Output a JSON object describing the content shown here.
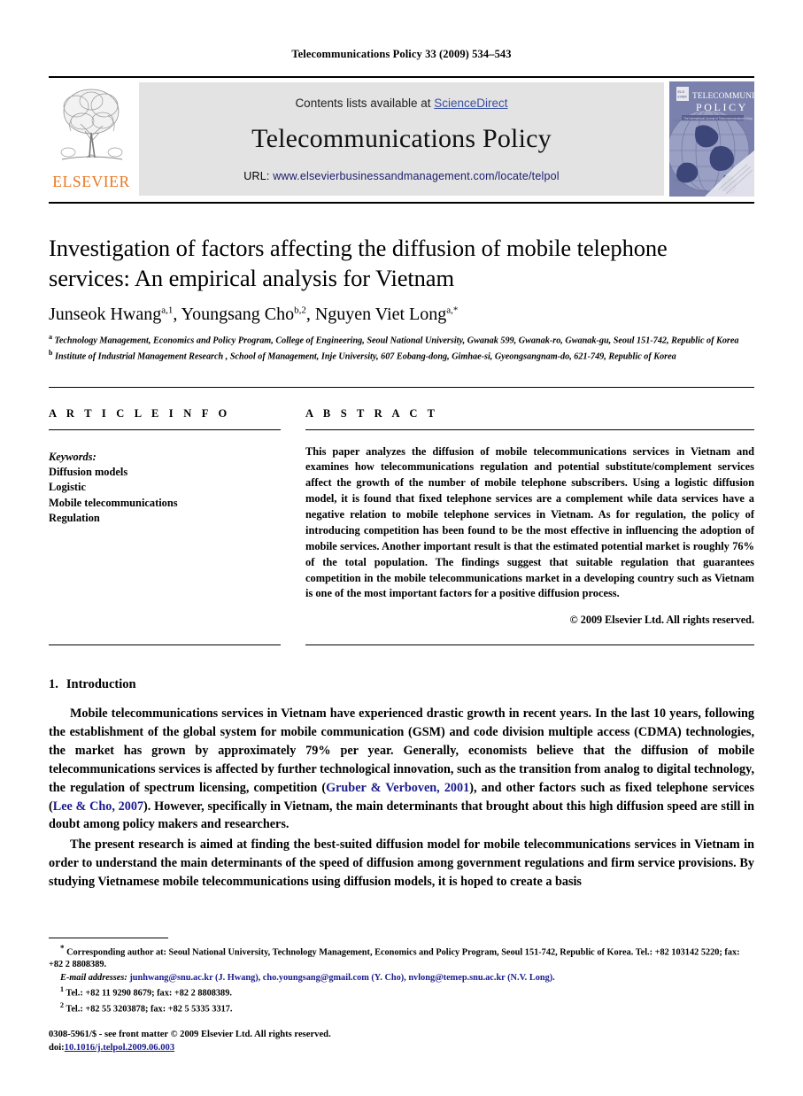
{
  "running_head": "Telecommunications Policy 33 (2009) 534–543",
  "masthead": {
    "publisher_name": "ELSEVIER",
    "contents_prefix": "Contents lists available at ",
    "contents_link": "ScienceDirect",
    "journal_title": "Telecommunications Policy",
    "url_label": "URL: ",
    "url_value": "www.elsevierbusinessandmanagement.com/locate/telpol",
    "cover_title_line1": "TELECOMMUNICATIONS",
    "cover_title_line2": "P O L I C Y",
    "band_color": "#e3e3e3",
    "link_color": "#3b4fa0",
    "elsevier_orange": "#E87722"
  },
  "article": {
    "title": "Investigation of factors affecting the diffusion of mobile telephone services: An empirical analysis for Vietnam",
    "authors": "Junseok Hwang a,1, Youngsang Cho b,2, Nguyen Viet Long a,*",
    "author_parts": [
      {
        "name": "Junseok Hwang",
        "marks": "a,1",
        "sep": ", "
      },
      {
        "name": "Youngsang Cho",
        "marks": "b,2",
        "sep": ", "
      },
      {
        "name": "Nguyen Viet Long",
        "marks": "a,*",
        "sep": ""
      }
    ],
    "affiliations": [
      {
        "mark": "a",
        "text": "Technology Management, Economics and Policy Program, College of Engineering, Seoul National University, Gwanak 599, Gwanak-ro, Gwanak-gu, Seoul 151-742, Republic of Korea"
      },
      {
        "mark": "b",
        "text": "Institute of Industrial Management Research , School of Management, Inje University, 607 Eobang-dong, Gimhae-si, Gyeongsangnam-do, 621-749, Republic of Korea"
      }
    ]
  },
  "article_info": {
    "heading": "A R T I C L E   I N F O",
    "keywords_label": "Keywords:",
    "keywords": [
      "Diffusion models",
      "Logistic",
      "Mobile telecommunications",
      "Regulation"
    ]
  },
  "abstract": {
    "heading": "A B S T R A C T",
    "text": "This paper analyzes the diffusion of mobile telecommunications services in Vietnam and examines how telecommunications regulation and potential substitute/complement services affect the growth of the number of mobile telephone subscribers. Using a logistic diffusion model, it is found that fixed telephone services are a complement while data services have a negative relation to mobile telephone services in Vietnam. As for regulation, the policy of introducing competition has been found to be the most effective in influencing the adoption of mobile services. Another important result is that the estimated potential market is roughly 76% of the total population. The findings suggest that suitable regulation that guarantees competition in the mobile telecommunications market in a developing country such as Vietnam is one of the most important factors for a positive diffusion process.",
    "copyright": "© 2009 Elsevier Ltd. All rights reserved."
  },
  "body": {
    "section_number": "1.",
    "section_title": "Introduction",
    "paragraph1_part1": "Mobile telecommunications services in Vietnam have experienced drastic growth in recent years. In the last 10 years, following the establishment of the global system for mobile communication (GSM) and code division multiple access (CDMA) technologies, the market has grown by approximately 79% per year. Generally, economists believe that the diffusion of mobile telecommunications services is affected by further technological innovation, such as the transition from analog to digital technology, the regulation of spectrum licensing, competition (",
    "citation1": "Gruber & Verboven, 2001",
    "paragraph1_part2": "), and other factors such as fixed telephone services (",
    "citation2": "Lee & Cho, 2007",
    "paragraph1_part3": "). However, specifically in Vietnam, the main determinants that brought about this high diffusion speed are still in doubt among policy makers and researchers.",
    "paragraph2": "The present research is aimed at finding the best-suited diffusion model for mobile telecommunications services in Vietnam in order to understand the main determinants of the speed of diffusion among government regulations and firm service provisions. By studying Vietnamese mobile telecommunications using diffusion models, it is hoped to create a basis"
  },
  "footnotes": {
    "corresponding": "Corresponding author at: Seoul National University, Technology Management, Economics and Policy Program, Seoul 151-742, Republic of Korea. Tel.: +82 103142 5220; fax: +82 2 8808389.",
    "email_label": "E-mail addresses:",
    "emails": "junhwang@snu.ac.kr (J. Hwang), cho.youngsang@gmail.com (Y. Cho), nvlong@temep.snu.ac.kr (N.V. Long).",
    "note1_mark": "1",
    "note1": "Tel.: +82 11 9290 8679; fax: +82 2 8808389.",
    "note2_mark": "2",
    "note2": "Tel.: +82 55 3203878; fax: +82 5 5335 3317."
  },
  "imprint": {
    "issn_line": "0308-5961/$ - see front matter © 2009 Elsevier Ltd. All rights reserved.",
    "doi_label": "doi:",
    "doi_value": "10.1016/j.telpol.2009.06.003"
  }
}
